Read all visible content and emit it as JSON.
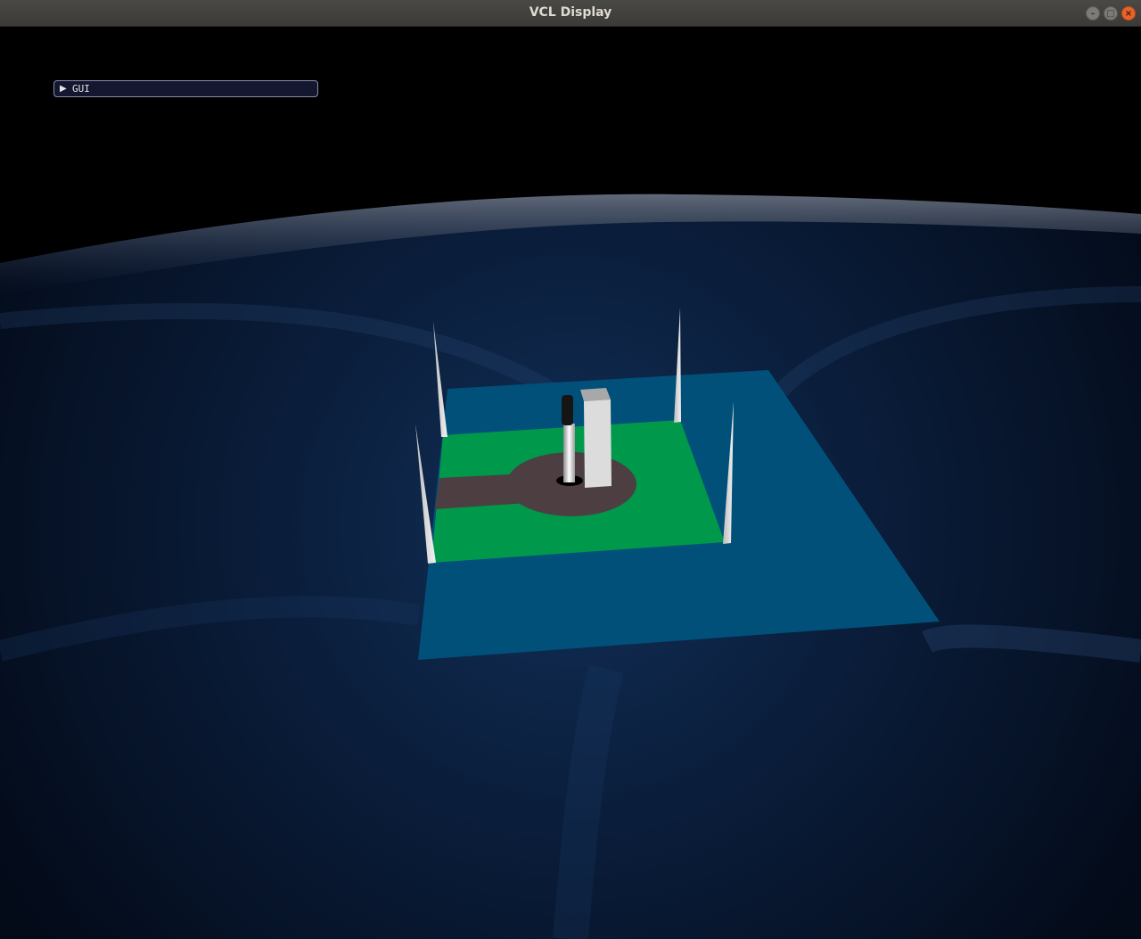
{
  "window": {
    "title": "VCL Display",
    "controls": {
      "minimize_icon": "minimize-icon",
      "maximize_icon": "maximize-icon",
      "close_icon": "close-icon"
    }
  },
  "gui": {
    "label": "GUI",
    "state_icon": "triangle-right-icon"
  },
  "colors": {
    "titlebar": "#3b3a36",
    "close_button": "#e9622a",
    "sky": "#000000",
    "terrain": "#0b1a33",
    "water": "#01507a",
    "grass": "#00994c",
    "pad": "#4d3e41",
    "building": "#d9d9d9",
    "gui_background": "#151731"
  }
}
